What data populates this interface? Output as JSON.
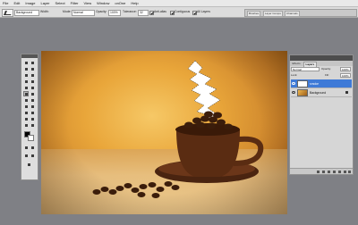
{
  "menu": [
    "File",
    "Edit",
    "Image",
    "Layer",
    "Select",
    "Filter",
    "View",
    "Window",
    "onOne",
    "Help"
  ],
  "options": {
    "mode_select": "Background",
    "feather_label": "Width:",
    "mode_label": "Mode:",
    "mode_value": "Normal",
    "opacity_label": "Opacity:",
    "opacity_value": "100%",
    "tolerance_label": "Tolerance:",
    "tolerance_value": "32",
    "anti_alias": "Anti-alias",
    "contiguous": "Contiguous",
    "all_layers": "All Layers"
  },
  "panel_well": [
    "Brushes",
    "Layer Comps",
    "Channels"
  ],
  "layers_panel": {
    "tabs": [
      "Effects",
      "Layers"
    ],
    "blend_mode": "Normal",
    "opacity_label": "Opacity:",
    "opacity_value": "100%",
    "lock_label": "Lock:",
    "fill_label": "Fill:",
    "fill_value": "100%",
    "layers": [
      {
        "name": "smoke",
        "selected": true
      },
      {
        "name": "Background",
        "selected": false
      }
    ]
  },
  "icons": {
    "tool_preset": "magic-eraser-icon",
    "eye": "eye-icon",
    "lock": "lock-icon"
  },
  "colors": {
    "selected_layer": "#3f7ad7",
    "foreground_swatch": "#000000",
    "background_swatch": "#ffffff"
  }
}
